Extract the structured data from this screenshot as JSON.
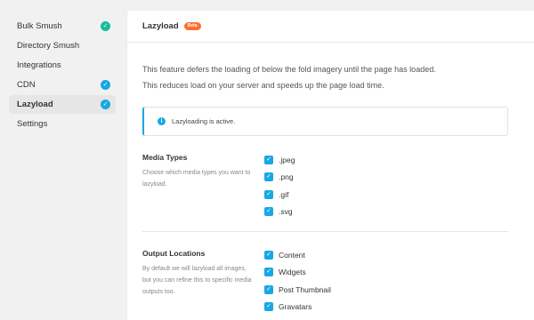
{
  "sidebar": {
    "items": [
      {
        "label": "Bulk Smush",
        "check": true,
        "check_color": "#1abc9c"
      },
      {
        "label": "Directory Smush",
        "check": false
      },
      {
        "label": "Integrations",
        "check": false
      },
      {
        "label": "CDN",
        "check": true,
        "check_color": "#17a8e3"
      },
      {
        "label": "Lazyload",
        "check": true,
        "check_color": "#17a8e3",
        "active": true
      },
      {
        "label": "Settings",
        "check": false
      }
    ]
  },
  "header": {
    "title": "Lazyload",
    "badge": "Beta"
  },
  "intro": {
    "line1": "This feature defers the loading of below the fold imagery until the page has loaded.",
    "line2": "This reduces load on your server and speeds up the page  load time."
  },
  "notice": {
    "icon": "info-icon",
    "text": "Lazyloading is active."
  },
  "media_types": {
    "title": "Media Types",
    "description": "Choose which media types you want to lazyload.",
    "options": [
      ".jpeg",
      ".png",
      ".gif",
      ".svg"
    ]
  },
  "output_locations": {
    "title": "Output Locations",
    "description": "By default we will lazyload all images, but you can refine this to specific media outputs too.",
    "options": [
      "Content",
      "Widgets",
      "Post Thumbnail",
      "Gravatars"
    ]
  },
  "colors": {
    "accent": "#17a8e3",
    "success": "#1abc9c",
    "beta": "#fd6e2f"
  }
}
